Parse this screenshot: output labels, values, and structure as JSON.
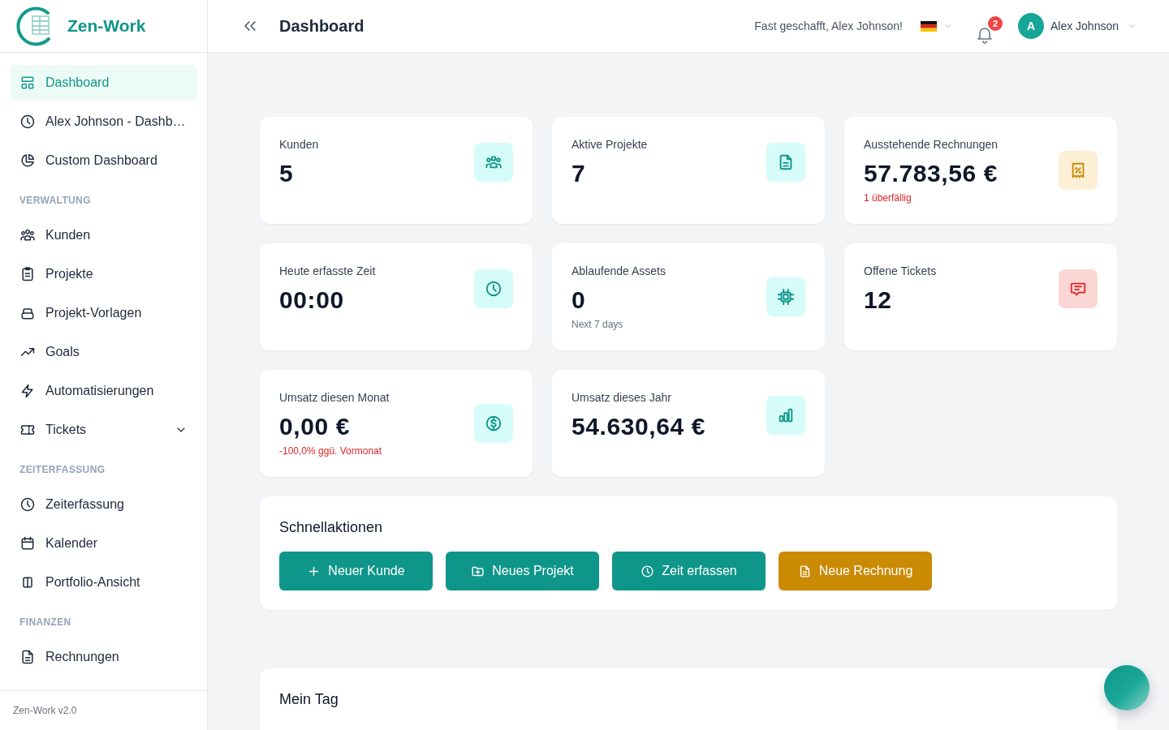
{
  "sidebar": {
    "brand": "Zen-Work",
    "sections": [
      {
        "items": [
          {
            "label": "Dashboard",
            "selected": true
          },
          {
            "label": "Alex Johnson - Dashb…",
            "selected": false
          },
          {
            "label": "Custom Dashboard",
            "selected": false
          }
        ]
      },
      {
        "heading": "VERWALTUNG",
        "items": [
          {
            "label": "Kunden",
            "selected": false
          },
          {
            "label": "Projekte",
            "selected": false
          },
          {
            "label": "Projekt-Vorlagen",
            "selected": false
          },
          {
            "label": "Goals",
            "selected": false
          },
          {
            "label": "Automatisierungen",
            "selected": false
          },
          {
            "label": "Tickets",
            "selected": false,
            "expanded": false
          }
        ]
      },
      {
        "heading": "ZEITERFASSUNG",
        "items": [
          {
            "label": "Zeiterfassung",
            "selected": false
          },
          {
            "label": "Kalender",
            "selected": false
          },
          {
            "label": "Portfolio-Ansicht",
            "selected": false
          }
        ]
      },
      {
        "heading": "FINANZEN",
        "items": [
          {
            "label": "Rechnungen",
            "selected": false
          }
        ]
      }
    ],
    "footer": "Zen-Work v2.0"
  },
  "header": {
    "title": "Dashboard",
    "greeting": "Fast geschafft, Alex Johnson!",
    "notification_count": "2",
    "user": {
      "initial": "A",
      "name": "Alex Johnson"
    }
  },
  "stats": [
    {
      "label": "Kunden",
      "value": "5",
      "color": "#0d9488"
    },
    {
      "label": "Aktive Projekte",
      "value": "7",
      "color": "#0d9488"
    },
    {
      "label": "Ausstehende Rechnungen",
      "value": "57.783,56 €",
      "note": {
        "text": "1 überfällig",
        "kind": "alert"
      },
      "color": "#ca8a04"
    },
    {
      "label": "Heute erfasste Zeit",
      "value": "00:00",
      "color": "#0d9488"
    },
    {
      "label": "Ablaufende Assets",
      "value": "0",
      "note": {
        "text": "Next 7 days",
        "kind": "muted"
      },
      "color": "#0d9488"
    },
    {
      "label": "Offene Tickets",
      "value": "12",
      "color": "#dc2626"
    },
    {
      "label": "Umsatz diesen Monat",
      "value": "0,00 €",
      "note": {
        "text": "-100,0% ggü. Vormonat",
        "kind": "alert"
      },
      "color": "#0d9488"
    },
    {
      "label": "Umsatz dieses Jahr",
      "value": "54.630,64 €",
      "color": "#0d9488"
    }
  ],
  "quick_actions": {
    "title": "Schnellaktionen",
    "buttons": [
      {
        "label": "Neuer Kunde",
        "color": "#0f968a"
      },
      {
        "label": "Neues Projekt",
        "color": "#0f968a"
      },
      {
        "label": "Zeit erfassen",
        "color": "#0f968a"
      },
      {
        "label": "Neue Rechnung",
        "color": "#ca8a04"
      }
    ]
  },
  "my_day": {
    "title": "Mein Tag"
  }
}
